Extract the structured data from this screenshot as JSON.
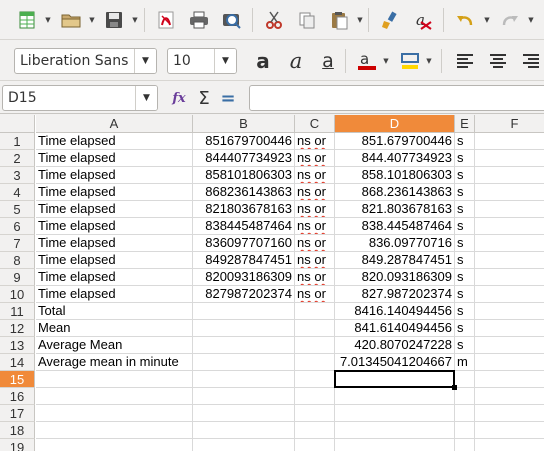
{
  "toolbar1": {
    "icons": [
      "new-spreadsheet-icon",
      "open-folder-icon",
      "save-icon",
      "export-pdf-icon",
      "print-icon",
      "print-preview-icon",
      "cut-icon",
      "copy-icon",
      "paste-icon",
      "clone-formatting-icon",
      "clear-formatting-icon",
      "undo-icon",
      "redo-icon"
    ]
  },
  "toolbar2": {
    "font_name": "Liberation Sans",
    "font_size": "10",
    "bold_label": "a",
    "italic_label": "a",
    "underline_label": "a",
    "font_color": "#cc0000",
    "highlight_color": "#ffd700"
  },
  "formula_bar": {
    "name_box": "D15",
    "function_wizard_label": "fx",
    "sum_label": "Σ",
    "equals_label": "=",
    "formula": ""
  },
  "sheet": {
    "columns": [
      "A",
      "B",
      "C",
      "D",
      "E",
      "F"
    ],
    "active_column": "D",
    "active_row": "15",
    "rows": [
      {
        "n": "1",
        "a": "Time elapsed",
        "b": "851679700446",
        "c": "ns or",
        "d": "851.679700446",
        "e": "s"
      },
      {
        "n": "2",
        "a": "Time elapsed",
        "b": "844407734923",
        "c": "ns or",
        "d": "844.407734923",
        "e": "s"
      },
      {
        "n": "3",
        "a": "Time elapsed",
        "b": "858101806303",
        "c": "ns or",
        "d": "858.101806303",
        "e": "s"
      },
      {
        "n": "4",
        "a": "Time elapsed",
        "b": "868236143863",
        "c": "ns or",
        "d": "868.236143863",
        "e": "s"
      },
      {
        "n": "5",
        "a": "Time elapsed",
        "b": "821803678163",
        "c": "ns or",
        "d": "821.803678163",
        "e": "s"
      },
      {
        "n": "6",
        "a": "Time elapsed",
        "b": "838445487464",
        "c": "ns or",
        "d": "838.445487464",
        "e": "s"
      },
      {
        "n": "7",
        "a": "Time elapsed",
        "b": "836097707160",
        "c": "ns or",
        "d": "836.09770716",
        "e": "s"
      },
      {
        "n": "8",
        "a": "Time elapsed",
        "b": "849287847451",
        "c": "ns or",
        "d": "849.287847451",
        "e": "s"
      },
      {
        "n": "9",
        "a": "Time elapsed",
        "b": "820093186309",
        "c": "ns or",
        "d": "820.093186309",
        "e": "s"
      },
      {
        "n": "10",
        "a": "Time elapsed",
        "b": "827987202374",
        "c": "ns or",
        "d": "827.987202374",
        "e": "s"
      },
      {
        "n": "11",
        "a": "Total",
        "b": "",
        "c": "",
        "d": "8416.140494456",
        "e": "s"
      },
      {
        "n": "12",
        "a": "Mean",
        "b": "",
        "c": "",
        "d": "841.6140494456",
        "e": "s"
      },
      {
        "n": "13",
        "a": "Average Mean",
        "b": "",
        "c": "",
        "d": "420.8070247228",
        "e": "s"
      },
      {
        "n": "14",
        "a": "Average mean in minute",
        "b": "",
        "c": "",
        "d": "7.01345041204667",
        "e": "m"
      },
      {
        "n": "15",
        "a": "",
        "b": "",
        "c": "",
        "d": "",
        "e": ""
      },
      {
        "n": "16",
        "a": "",
        "b": "",
        "c": "",
        "d": "",
        "e": ""
      },
      {
        "n": "17",
        "a": "",
        "b": "",
        "c": "",
        "d": "",
        "e": ""
      },
      {
        "n": "18",
        "a": "",
        "b": "",
        "c": "",
        "d": "",
        "e": ""
      },
      {
        "n": "19",
        "a": "",
        "b": "",
        "c": "",
        "d": "",
        "e": ""
      }
    ]
  }
}
